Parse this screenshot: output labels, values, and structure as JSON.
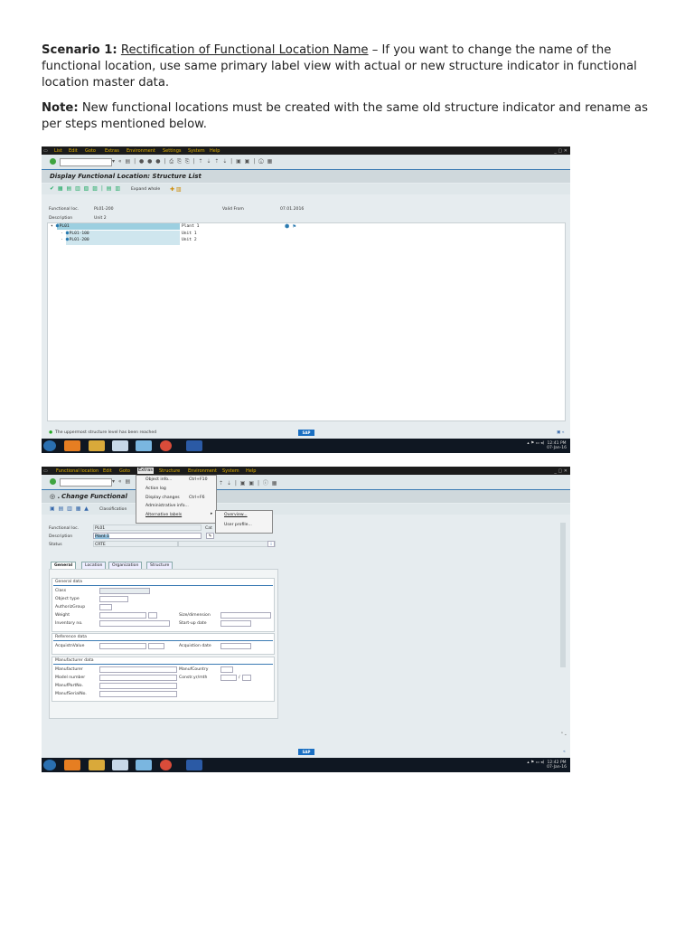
{
  "doc": {
    "scenario_label": "Scenario 1:",
    "scenario_title": "Rectification of Functional Location Name",
    "scenario_text": " – If you want to change the name of the functional location, use same primary label view with actual or new structure indicator in functional location master data.",
    "note_label": "Note:",
    "note_text": " New functional locations must be created with the same old structure indicator and rename as per steps mentioned below."
  },
  "shot1": {
    "menu": [
      "List",
      "Edit",
      "Goto",
      "Extras",
      "Environment",
      "Settings",
      "System",
      "Help"
    ],
    "title": "Display Functional Location: Structure List",
    "expand_label": "Expand whole",
    "func_loc_label": "Functional loc.",
    "func_loc_value": "PL01-200",
    "valid_from_label": "Valid From",
    "valid_from_value": "07.01.2016",
    "desc_label": "Description",
    "desc_value": "Unit 2",
    "tree": [
      {
        "id": "PL01",
        "text": "Plant 1"
      },
      {
        "id": "PL01-100",
        "text": "Unit 1"
      },
      {
        "id": "PL01-200",
        "text": "Unit 2"
      }
    ],
    "status_msg": "The uppermost structure level has been reached",
    "sap": "SAP",
    "clock": "12:41 PM",
    "date": "07-Jan-16"
  },
  "shot2": {
    "menu": [
      "Functional location",
      "Edit",
      "Goto",
      "Extras",
      "Structure",
      "Environment",
      "System",
      "Help"
    ],
    "title": "Change Functional",
    "classification_label": "Classification",
    "dropdown": [
      {
        "label": "Object info...",
        "key": "Ctrl+F10"
      },
      {
        "label": "Action log",
        "key": ""
      },
      {
        "label": "Display changes",
        "key": "Ctrl+F6"
      },
      {
        "label": "Administrative info...",
        "key": ""
      },
      {
        "label": "Alternative labels",
        "key": ""
      }
    ],
    "submenu": [
      "Overview...",
      "User profile..."
    ],
    "func_loc_label": "Functional loc.",
    "func_loc_value": "PL01",
    "cat_label": "Cat",
    "desc_label": "Description",
    "desc_value": "Plant 1",
    "status_label": "Status",
    "status_value": "CRTE",
    "tabs": [
      "General",
      "Location",
      "Organization",
      "Structure"
    ],
    "general_title": "General data",
    "general_fields": [
      "Class",
      "Object type",
      "AuthorizGroup",
      "Weight",
      "Inventory no."
    ],
    "size_label": "Size/dimension",
    "startup_label": "Start-up date",
    "ref_title": "Reference data",
    "acq_value_label": "AcquistnValue",
    "acq_date_label": "Acquistion date",
    "mfr_title": "Manufacturer data",
    "mfr_fields": [
      "Manufacturer",
      "Model number",
      "ManufPartNo.",
      "ManufSerialNo."
    ],
    "mfr_country_label": "ManufCountry",
    "constr_label": "Constr.yr/mth",
    "constr_sep": "/",
    "sap": "SAP",
    "clock": "12:42 PM",
    "date": "07-Jan-16"
  },
  "colors": {
    "sap_blue": "#1a6fc2",
    "menu_bar": "#1b1b1b",
    "menu_text": "#e0b000",
    "taskbar": "#0f1722"
  }
}
